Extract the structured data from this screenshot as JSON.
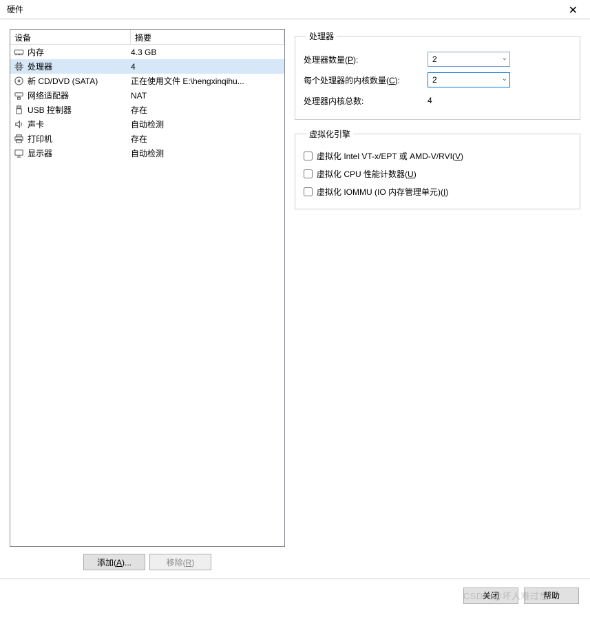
{
  "window": {
    "title": "硬件"
  },
  "device_table": {
    "header_device": "设备",
    "header_summary": "摘要",
    "rows": [
      {
        "icon": "memory",
        "label": "内存",
        "summary": "4.3 GB",
        "selected": false
      },
      {
        "icon": "cpu",
        "label": "处理器",
        "summary": "4",
        "selected": true
      },
      {
        "icon": "disc",
        "label": "新 CD/DVD (SATA)",
        "summary": "正在使用文件 E:\\hengxinqihu...",
        "selected": false
      },
      {
        "icon": "network",
        "label": "网络适配器",
        "summary": "NAT",
        "selected": false
      },
      {
        "icon": "usb",
        "label": "USB 控制器",
        "summary": "存在",
        "selected": false
      },
      {
        "icon": "sound",
        "label": "声卡",
        "summary": "自动检测",
        "selected": false
      },
      {
        "icon": "printer",
        "label": "打印机",
        "summary": "存在",
        "selected": false
      },
      {
        "icon": "display",
        "label": "显示器",
        "summary": "自动检测",
        "selected": false
      }
    ]
  },
  "left_buttons": {
    "add": "添加(A)...",
    "add_accel": "A",
    "remove": "移除(R)",
    "remove_accel": "R"
  },
  "processor_group": {
    "legend": "处理器",
    "count_label": "处理器数量(P):",
    "count_accel": "P",
    "count_value": "2",
    "cores_label": "每个处理器的内核数量(C):",
    "cores_accel": "C",
    "cores_value": "2",
    "total_label": "处理器内核总数:",
    "total_value": "4"
  },
  "virt_group": {
    "legend": "虚拟化引擎",
    "vt_label": "虚拟化 Intel VT-x/EPT 或 AMD-V/RVI(V)",
    "vt_accel": "V",
    "perf_label": "虚拟化 CPU 性能计数器(U)",
    "perf_accel": "U",
    "iommu_label": "虚拟化 IOMMU (IO 内存管理单元)(I)",
    "iommu_accel": "I"
  },
  "footer": {
    "close": "关闭",
    "help": "帮助"
  },
  "watermark": "CSDN @坏人难过想"
}
